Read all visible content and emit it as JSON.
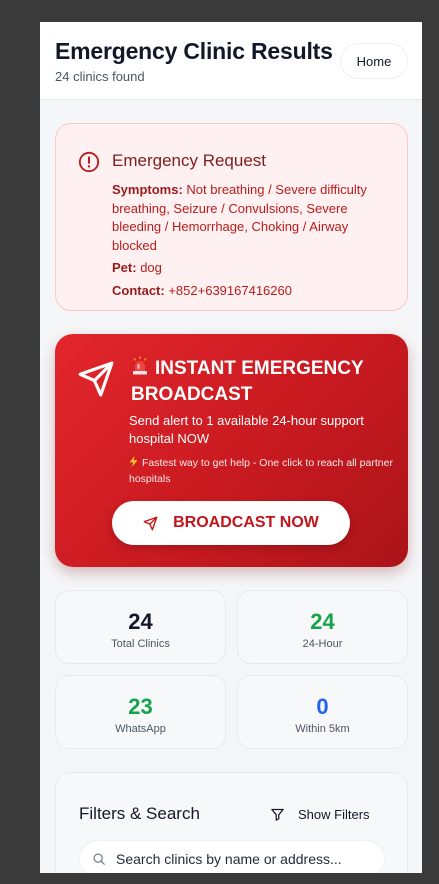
{
  "header": {
    "title": "Emergency Clinic Results",
    "subtitle": "24 clinics found",
    "home_label": "Home"
  },
  "request": {
    "title": "Emergency Request",
    "symptoms_label": "Symptoms:",
    "symptoms_value": "Not breathing / Severe difficulty breathing, Seizure / Convulsions, Severe bleeding / Hemorrhage, Choking / Airway blocked",
    "pet_label": "Pet:",
    "pet_value": "dog",
    "contact_label": "Contact:",
    "contact_value": "+852+639167416260"
  },
  "broadcast": {
    "title": "INSTANT EMERGENCY BROADCAST",
    "subtitle": "Send alert to 1 available 24-hour support hospital NOW",
    "note": "Fastest way to get help - One click to reach all partner hospitals",
    "button_label": "BROADCAST NOW"
  },
  "stats": [
    {
      "value": "24",
      "label": "Total Clinics",
      "color": "#111827"
    },
    {
      "value": "24",
      "label": "24-Hour",
      "color": "#16a34a"
    },
    {
      "value": "23",
      "label": "WhatsApp",
      "color": "#16a34a"
    },
    {
      "value": "0",
      "label": "Within 5km",
      "color": "#2563eb"
    }
  ],
  "filters": {
    "title": "Filters & Search",
    "toggle_label": "Show Filters",
    "search_placeholder": "Search clinics by name or address..."
  },
  "colors": {
    "accent_red": "#c81a20",
    "alert_bg": "#fff1f1",
    "green": "#16a34a",
    "blue": "#2563eb"
  }
}
